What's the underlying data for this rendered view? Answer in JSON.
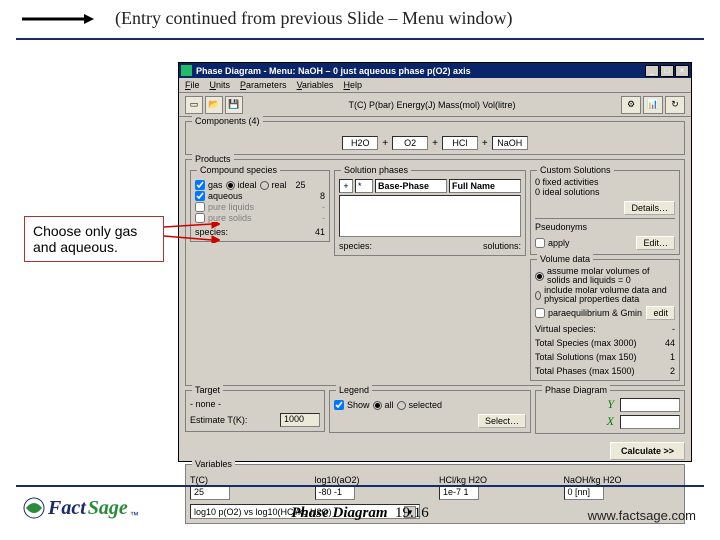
{
  "slide": {
    "header": "(Entry continued from previous Slide – Menu window)",
    "callout": "Choose only gas and aqueous.",
    "footer_module": "Phase Diagram",
    "footer_pageno": "19.16",
    "footer_url": "www.factsage.com",
    "logo_fact": "Fact",
    "logo_sage": "Sage"
  },
  "window": {
    "title": "Phase Diagram - Menu: NaOH – 0 just aqueous phase p(O2) axis",
    "menubar": [
      "File",
      "Units",
      "Parameters",
      "Variables",
      "Help"
    ],
    "toolbar_mid": "T(C) P(bar) Energy(J) Mass(mol) Vol(litre)",
    "components": {
      "legend": "Components (4)",
      "items": [
        "H2O",
        "O2",
        "HCl",
        "NaOH"
      ]
    },
    "products": {
      "legend": "Products",
      "compound": {
        "legend": "Compound species",
        "rows": [
          {
            "label": "gas",
            "opt1": "ideal",
            "opt2": "real",
            "count": "25",
            "checked": true
          },
          {
            "label": "aqueous",
            "count": "8",
            "checked": true
          },
          {
            "label": "pure liquids",
            "count": "-",
            "checked": false
          },
          {
            "label": "pure solids",
            "count": "-",
            "checked": false
          }
        ],
        "species_label": "species:",
        "species_count": "41"
      },
      "solution": {
        "legend": "Solution phases",
        "hdr_plus": "+",
        "hdr_base": "Base-Phase",
        "hdr_full": "Full Name",
        "species_label": "species:",
        "solutions_label": "solutions:"
      },
      "custom": {
        "legend": "Custom Solutions",
        "lines": [
          "0  fixed activities",
          "0  ideal solutions"
        ],
        "details_btn": "Details…",
        "pseudo_legend": "Pseudonyms",
        "apply_label": "apply",
        "edit_btn": "Edit…"
      },
      "volume": {
        "legend": "Volume data",
        "opt1": "assume molar volumes of solids and liquids = 0",
        "opt2": "include molar volume data and physical properties data",
        "paraequil": "paraequilibrium & Gmin",
        "edit_btn": "edit",
        "virtual": "Virtual species:",
        "tot_spec": "Total Species (max 3000)",
        "tot_soln": "Total Solutions (max 150)",
        "tot_phase": "Total Phases (max 1500)",
        "v_virtual": "-",
        "v_spec": "44",
        "v_soln": "1",
        "v_phase": "2"
      }
    },
    "target": {
      "legend": "Target",
      "none": "- none -",
      "est_label": "Estimate T(K):",
      "est_value": "1000"
    },
    "legend_box": {
      "legend": "Legend",
      "show": "Show",
      "all": "all",
      "selected": "selected",
      "select_btn": "Select…"
    },
    "phase_diagram": {
      "legend": "Phase Diagram",
      "y": "Y",
      "x": "X",
      "calc": "Calculate >>"
    },
    "variables": {
      "legend": "Variables",
      "cols": [
        {
          "lbl": "T(C)",
          "val": "25"
        },
        {
          "lbl": "log10(aO2)",
          "val": "-80 -1"
        },
        {
          "lbl": "HCl/kg H2O",
          "val": "1e-7 1"
        },
        {
          "lbl": "NaOH/kg H2O",
          "val": "0 [nn]"
        }
      ],
      "axis_dropdown": "log10 p(O2) vs log10(HCl/kg H2O)"
    }
  }
}
